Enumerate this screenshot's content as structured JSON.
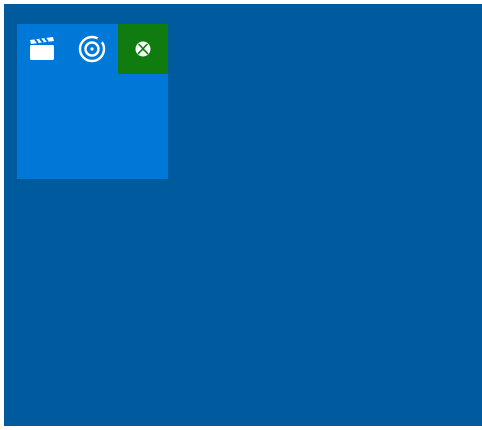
{
  "start_menu": {
    "tiles": [
      {
        "label": "",
        "icon": "clapperboard-icon"
      },
      {
        "label": "",
        "icon": "disc-icon"
      },
      {
        "label": "",
        "icon": "xbox-icon"
      }
    ]
  },
  "colors": {
    "background": "#005a9e",
    "tile_group": "#0078d7",
    "xbox_tile": "#107c10",
    "icon": "#ffffff"
  }
}
